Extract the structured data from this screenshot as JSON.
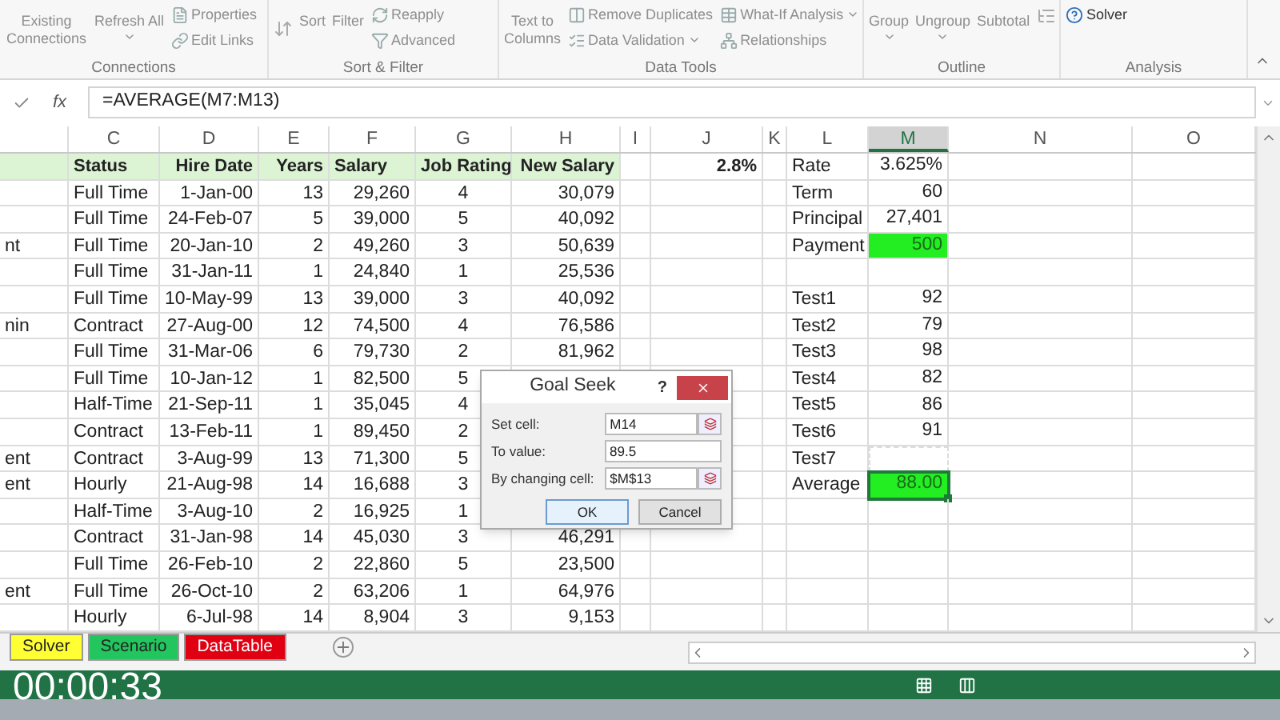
{
  "ribbon": {
    "groups": [
      {
        "label": "Connections",
        "columns": [
          [
            {
              "kind": "large",
              "label": "Existing Connections",
              "dropdown": false,
              "disabled": true
            }
          ],
          [
            {
              "kind": "large",
              "label": "Refresh All",
              "dropdown": true,
              "disabled": true
            }
          ],
          [
            {
              "kind": "small",
              "label": "Properties",
              "dropdown": false,
              "disabled": true
            },
            {
              "kind": "small",
              "label": "Edit Links",
              "dropdown": false,
              "disabled": true
            }
          ]
        ]
      },
      {
        "label": "Sort & Filter",
        "columns": [
          [
            {
              "kind": "icon",
              "disabled": true
            }
          ],
          [
            {
              "kind": "large",
              "label": "Sort",
              "dropdown": false,
              "disabled": true
            }
          ],
          [
            {
              "kind": "large",
              "label": "Filter",
              "dropdown": false,
              "disabled": true
            }
          ],
          [
            {
              "kind": "small",
              "label": "Reapply",
              "dropdown": false,
              "disabled": true
            },
            {
              "kind": "small",
              "label": "Advanced",
              "dropdown": false,
              "disabled": true
            }
          ]
        ]
      },
      {
        "label": "Data Tools",
        "columns": [
          [
            {
              "kind": "large",
              "label": "Text to Columns",
              "dropdown": false,
              "disabled": true
            }
          ],
          [
            {
              "kind": "small",
              "label": "Remove Duplicates",
              "dropdown": false,
              "disabled": true
            },
            {
              "kind": "small",
              "label": "Data Validation",
              "dropdown": true,
              "disabled": true
            }
          ],
          [
            {
              "kind": "small",
              "label": "What-If Analysis",
              "dropdown": true,
              "disabled": true
            },
            {
              "kind": "small",
              "label": "Relationships",
              "dropdown": false,
              "disabled": true
            }
          ]
        ]
      },
      {
        "label": "Outline",
        "columns": [
          [
            {
              "kind": "large",
              "label": "Group",
              "dropdown": true,
              "disabled": true
            }
          ],
          [
            {
              "kind": "large",
              "label": "Ungroup",
              "dropdown": true,
              "disabled": true
            }
          ],
          [
            {
              "kind": "large",
              "label": "Subtotal",
              "dropdown": false,
              "disabled": true
            }
          ],
          [
            {
              "kind": "icon",
              "disabled": true
            }
          ]
        ]
      },
      {
        "label": "Analysis",
        "columns": [
          [
            {
              "kind": "small",
              "label": "Solver",
              "dropdown": false,
              "disabled": false
            }
          ]
        ]
      }
    ]
  },
  "formula_bar": {
    "function_label": "fx",
    "formula": "=AVERAGE(M7:M13)"
  },
  "columns": [
    {
      "label": "C",
      "selected": false
    },
    {
      "label": "D",
      "selected": false
    },
    {
      "label": "E",
      "selected": false
    },
    {
      "label": "F",
      "selected": false
    },
    {
      "label": "G",
      "selected": false
    },
    {
      "label": "H",
      "selected": false
    },
    {
      "label": "I",
      "selected": false
    },
    {
      "label": "J",
      "selected": false
    },
    {
      "label": "K",
      "selected": false
    },
    {
      "label": "L",
      "selected": false
    },
    {
      "label": "M",
      "selected": true
    },
    {
      "label": "N",
      "selected": false
    },
    {
      "label": "O",
      "selected": false
    }
  ],
  "rows": [
    {
      "kind": "header",
      "status": "Status",
      "hire_date": "Hire Date",
      "years": "Years",
      "salary": "Salary",
      "job_rating": "Job Rating",
      "new_salary": "New Salary",
      "col_j": "2.8%",
      "col_l": "Rate",
      "col_m": {
        "text": "3.625%",
        "filled": false,
        "selected": false,
        "marquee": false
      }
    },
    {
      "kind": "data",
      "status": "Full Time",
      "hire_date": "1-Jan-00",
      "years": "13",
      "salary": "29,260",
      "job_rating": "4",
      "new_salary": "30,079",
      "col_l": "Term",
      "col_m": {
        "text": "60",
        "filled": false,
        "selected": false,
        "marquee": false
      }
    },
    {
      "kind": "data",
      "status": "Full Time",
      "hire_date": "24-Feb-07",
      "years": "5",
      "salary": "39,000",
      "job_rating": "5",
      "new_salary": "40,092",
      "col_l": "Principal",
      "col_m": {
        "text": "27,401",
        "filled": false,
        "selected": false,
        "marquee": false
      }
    },
    {
      "kind": "data",
      "col_b": "nt",
      "status": "Full Time",
      "hire_date": "20-Jan-10",
      "years": "2",
      "salary": "49,260",
      "job_rating": "3",
      "new_salary": "50,639",
      "col_l": "Payment",
      "col_m": {
        "text": "500",
        "filled": true,
        "selected": false,
        "marquee": false
      }
    },
    {
      "kind": "data",
      "status": "Full Time",
      "hire_date": "31-Jan-11",
      "years": "1",
      "salary": "24,840",
      "job_rating": "1",
      "new_salary": "25,536",
      "col_m": {
        "filled": false,
        "selected": false,
        "marquee": false
      }
    },
    {
      "kind": "data",
      "status": "Full Time",
      "hire_date": "10-May-99",
      "years": "13",
      "salary": "39,000",
      "job_rating": "3",
      "new_salary": "40,092",
      "col_l": "Test1",
      "col_m": {
        "text": "92",
        "filled": false,
        "selected": false,
        "marquee": false
      }
    },
    {
      "kind": "data",
      "col_b": "nin",
      "status": "Contract",
      "hire_date": "27-Aug-00",
      "years": "12",
      "salary": "74,500",
      "job_rating": "4",
      "new_salary": "76,586",
      "col_l": "Test2",
      "col_m": {
        "text": "79",
        "filled": false,
        "selected": false,
        "marquee": false
      }
    },
    {
      "kind": "data",
      "status": "Full Time",
      "hire_date": "31-Mar-06",
      "years": "6",
      "salary": "79,730",
      "job_rating": "2",
      "new_salary": "81,962",
      "col_l": "Test3",
      "col_m": {
        "text": "98",
        "filled": false,
        "selected": false,
        "marquee": false
      }
    },
    {
      "kind": "data",
      "status": "Full Time",
      "hire_date": "10-Jan-12",
      "years": "1",
      "salary": "82,500",
      "job_rating": "5",
      "col_l": "Test4",
      "col_m": {
        "text": "82",
        "filled": false,
        "selected": false,
        "marquee": false
      }
    },
    {
      "kind": "data",
      "status": "Half-Time",
      "hire_date": "21-Sep-11",
      "years": "1",
      "salary": "35,045",
      "job_rating": "4",
      "col_l": "Test5",
      "col_m": {
        "text": "86",
        "filled": false,
        "selected": false,
        "marquee": false
      }
    },
    {
      "kind": "data",
      "status": "Contract",
      "hire_date": "13-Feb-11",
      "years": "1",
      "salary": "89,450",
      "job_rating": "2",
      "col_l": "Test6",
      "col_m": {
        "text": "91",
        "filled": false,
        "selected": false,
        "marquee": false
      }
    },
    {
      "kind": "data",
      "col_b": "ent",
      "status": "Contract",
      "hire_date": "3-Aug-99",
      "years": "13",
      "salary": "71,300",
      "job_rating": "5",
      "col_l": "Test7",
      "col_m": {
        "filled": false,
        "selected": false,
        "marquee": true
      }
    },
    {
      "kind": "data",
      "col_b": "ent",
      "status": "Hourly",
      "hire_date": "21-Aug-98",
      "years": "14",
      "salary": "16,688",
      "job_rating": "3",
      "col_l": "Average",
      "col_m": {
        "text": "88.00",
        "filled": true,
        "selected": true,
        "marquee": false
      }
    },
    {
      "kind": "data",
      "status": "Half-Time",
      "hire_date": "3-Aug-10",
      "years": "2",
      "salary": "16,925",
      "job_rating": "1",
      "col_m": {
        "filled": false,
        "selected": false,
        "marquee": false
      }
    },
    {
      "kind": "data",
      "status": "Contract",
      "hire_date": "31-Jan-98",
      "years": "14",
      "salary": "45,030",
      "job_rating": "3",
      "new_salary": "46,291",
      "col_m": {
        "filled": false,
        "selected": false,
        "marquee": false
      }
    },
    {
      "kind": "data",
      "status": "Full Time",
      "hire_date": "26-Feb-10",
      "years": "2",
      "salary": "22,860",
      "job_rating": "5",
      "new_salary": "23,500",
      "col_m": {
        "filled": false,
        "selected": false,
        "marquee": false
      }
    },
    {
      "kind": "data",
      "col_b": "ent",
      "status": "Full Time",
      "hire_date": "26-Oct-10",
      "years": "2",
      "salary": "63,206",
      "job_rating": "1",
      "new_salary": "64,976",
      "col_m": {
        "filled": false,
        "selected": false,
        "marquee": false
      }
    },
    {
      "kind": "data",
      "status": "Hourly",
      "hire_date": "6-Jul-98",
      "years": "14",
      "salary": "8,904",
      "job_rating": "3",
      "new_salary": "9,153",
      "col_m": {
        "filled": false,
        "selected": false,
        "marquee": false
      }
    }
  ],
  "dialog": {
    "title": "Goal Seek",
    "help": "?",
    "fields": [
      {
        "label": "Set cell:",
        "value": "M14",
        "picker": true
      },
      {
        "label": "To value:",
        "value": "89.5",
        "picker": false
      },
      {
        "label": "By changing cell:",
        "value": "$M$13",
        "picker": true
      }
    ],
    "buttons": [
      "OK",
      "Cancel"
    ]
  },
  "sheet_tabs": [
    {
      "label": "Solver",
      "color": "#ffff33"
    },
    {
      "label": "Scenario",
      "color": "#22c55e"
    },
    {
      "label": "DataTable",
      "color": "#e00012"
    }
  ],
  "video_time": "00:00:33"
}
